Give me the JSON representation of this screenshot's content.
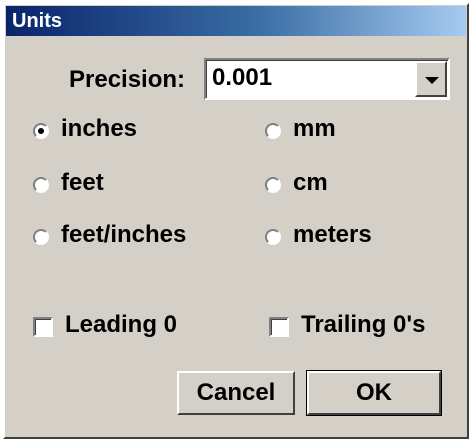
{
  "window": {
    "title": "Units"
  },
  "precision": {
    "label": "Precision:",
    "value": "0.001"
  },
  "units": {
    "selected": "inches",
    "options": [
      "inches",
      "mm",
      "feet",
      "cm",
      "feet/inches",
      "meters"
    ]
  },
  "options": {
    "leading_zero": {
      "label": "Leading 0",
      "checked": false
    },
    "trailing_zeros": {
      "label": "Trailing 0's",
      "checked": false
    }
  },
  "buttons": {
    "cancel": "Cancel",
    "ok": "OK"
  }
}
